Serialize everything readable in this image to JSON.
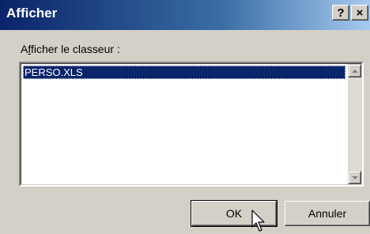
{
  "window": {
    "title": "Afficher",
    "help_label": "?",
    "close_label": "×"
  },
  "prompt": {
    "before": "A",
    "accel": "f",
    "after": "ficher le classeur :"
  },
  "list": {
    "items": [
      {
        "label": "PERSO.XLS",
        "selected": true
      }
    ]
  },
  "buttons": {
    "ok_label": "OK",
    "cancel_label": "Annuler"
  },
  "colors": {
    "titlebar_start": "#0a246a",
    "titlebar_end": "#a6caf0",
    "selection": "#0a246a",
    "face": "#d4d0c8"
  }
}
